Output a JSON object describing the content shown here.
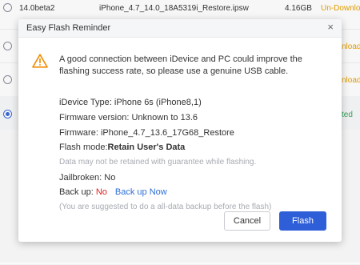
{
  "background": {
    "rows": [
      {
        "version": "14.0beta2",
        "file": "iPhone_4.7_14.0_18A5319i_Restore.ipsw",
        "size": "4.16GB",
        "status": "Un-Downloa"
      },
      {
        "status": "nload"
      },
      {
        "status": "nload"
      },
      {
        "status": "ted"
      }
    ]
  },
  "dialog": {
    "title": "Easy Flash Reminder",
    "close_glyph": "×",
    "message": "A good connection between iDevice and PC could improve the flashing success rate, so please use a genuine USB cable.",
    "device_type": "iDevice Type: iPhone 6s (iPhone8,1)",
    "firmware_version": "Firmware version: Unknown  to  13.6",
    "firmware": "Firmware: iPhone_4.7_13.6_17G68_Restore",
    "flash_mode_label": "Flash mode:",
    "flash_mode_value": "Retain User's Data",
    "data_note": "Data may not be retained with guarantee while flashing.",
    "jailbroken": "Jailbroken: No",
    "backup_label": "Back up: ",
    "backup_value": "No",
    "backup_link": "Back up Now",
    "backup_note": "(You are suggested to do a all-data backup before the flash)",
    "cancel_label": "Cancel",
    "flash_label": "Flash"
  },
  "colors": {
    "accent": "#2f5fd8",
    "warning": "#f08c00",
    "error": "#e02020",
    "link": "#2f6fd6",
    "status_download": "#e8a100",
    "status_done": "#3aa85a"
  }
}
